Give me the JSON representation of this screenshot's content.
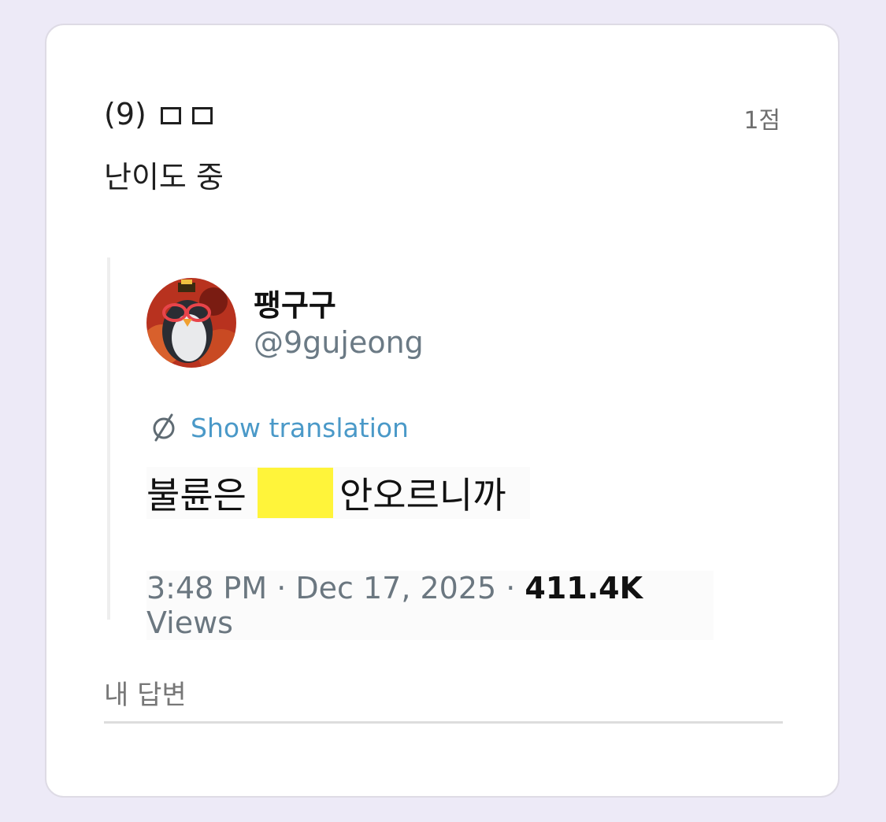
{
  "question": {
    "number": "(9)",
    "points": "1점",
    "difficulty": "난이도 중"
  },
  "tweet": {
    "name": "팽구구",
    "handle": "@9gujeong",
    "translate_label": "Show translation",
    "text_before": "불륜은",
    "text_after": "안오르니까",
    "time": "3:48 PM · Dec 17, 2025 · ",
    "views_count": "411.4K",
    "views_label": " Views",
    "highlight_color": "#fff43a"
  },
  "answer": {
    "placeholder": "내 답변"
  },
  "colors": {
    "background": "#edeaf7",
    "card": "#ffffff",
    "link": "#4a99c8"
  }
}
